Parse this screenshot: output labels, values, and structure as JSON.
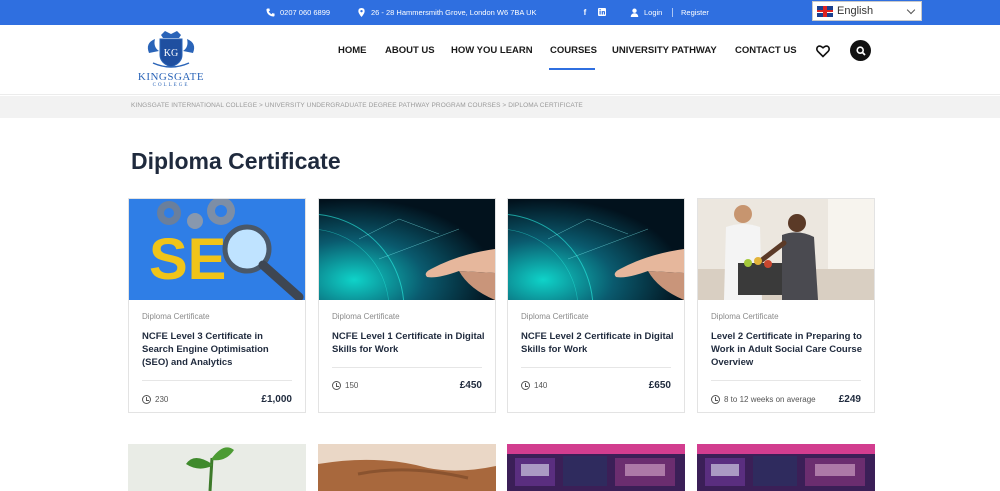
{
  "topbar": {
    "phone": "0207 060 6899",
    "address": "26 - 28 Hammersmith Grove, London W6 7BA UK",
    "login": "Login",
    "register": "Register",
    "social": [
      "facebook-icon",
      "linkedin-icon"
    ]
  },
  "language": {
    "selected": "English"
  },
  "logo": {
    "name": "KINGSGATE",
    "sub": "COLLEGE",
    "monogram": "KG"
  },
  "nav": {
    "items": [
      "HOME",
      "ABOUT US",
      "HOW YOU LEARN",
      "COURSES",
      "UNIVERSITY PATHWAY",
      "CONTACT US"
    ],
    "active": "COURSES"
  },
  "breadcrumb": "KINGSGATE INTERNATIONAL COLLEGE > UNIVERSITY UNDERGRADUATE DEGREE PATHWAY PROGRAM COURSES > DIPLOMA CERTIFICATE",
  "page_title": "Diploma Certificate",
  "cards": [
    {
      "category": "Diploma Certificate",
      "title": "NCFE Level 3 Certificate in Search Engine Optimisation (SEO) and Analytics",
      "meta": "230",
      "price": "£1,000",
      "image": "seo"
    },
    {
      "category": "Diploma Certificate",
      "title": "NCFE Level 1 Certificate in Digital Skills for Work",
      "meta": "150",
      "price": "£450",
      "image": "digital"
    },
    {
      "category": "Diploma Certificate",
      "title": "NCFE Level 2 Certificate in Digital Skills for Work",
      "meta": "140",
      "price": "£650",
      "image": "digital"
    },
    {
      "category": "Diploma Certificate",
      "title": "Level 2 Certificate in Preparing to Work in Adult Social Care Course Overview",
      "meta": "8 to 12 weeks on average",
      "price": "£249",
      "image": "care"
    }
  ],
  "colors": {
    "topbar": "#2f6fe0",
    "title": "#1f2a3d",
    "accent": "#2f6fe0"
  }
}
